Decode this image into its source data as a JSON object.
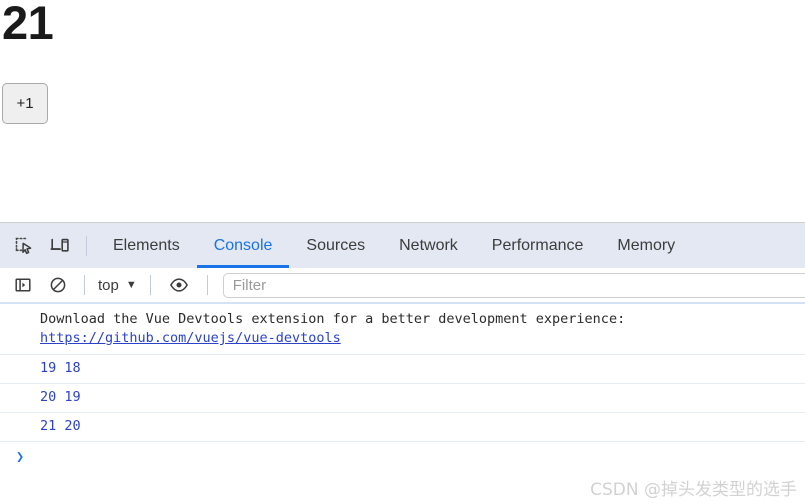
{
  "page": {
    "counter_value": "21",
    "increment_button_label": "+1"
  },
  "devtools": {
    "tabbar": {
      "inspect_icon": "inspect-element-icon",
      "device_icon": "device-toolbar-icon",
      "tabs": [
        {
          "label": "Elements",
          "active": false
        },
        {
          "label": "Console",
          "active": true
        },
        {
          "label": "Sources",
          "active": false
        },
        {
          "label": "Network",
          "active": false
        },
        {
          "label": "Performance",
          "active": false
        },
        {
          "label": "Memory",
          "active": false
        }
      ]
    },
    "console_toolbar": {
      "sidebar_toggle_icon": "sidebar-toggle-icon",
      "clear_console_icon": "clear-console-icon",
      "context_label": "top",
      "context_caret": "▼",
      "eye_icon": "eye-icon",
      "filter_placeholder": "Filter",
      "filter_value": ""
    },
    "messages": [
      {
        "type": "info",
        "text": "Download the Vue Devtools extension for a better development experience:",
        "link": "https://github.com/vuejs/vue-devtools"
      },
      {
        "type": "log",
        "text": "19 18"
      },
      {
        "type": "log",
        "text": "20 19"
      },
      {
        "type": "log",
        "text": "21 20"
      }
    ],
    "prompt_symbol": "❯"
  },
  "watermark": "CSDN @掉头发类型的选手",
  "colors": {
    "accent_blue": "#1a73e8",
    "tabbar_bg": "#e3e8f3",
    "log_text": "#2b42c9",
    "watermark": "#d2d2d2"
  }
}
